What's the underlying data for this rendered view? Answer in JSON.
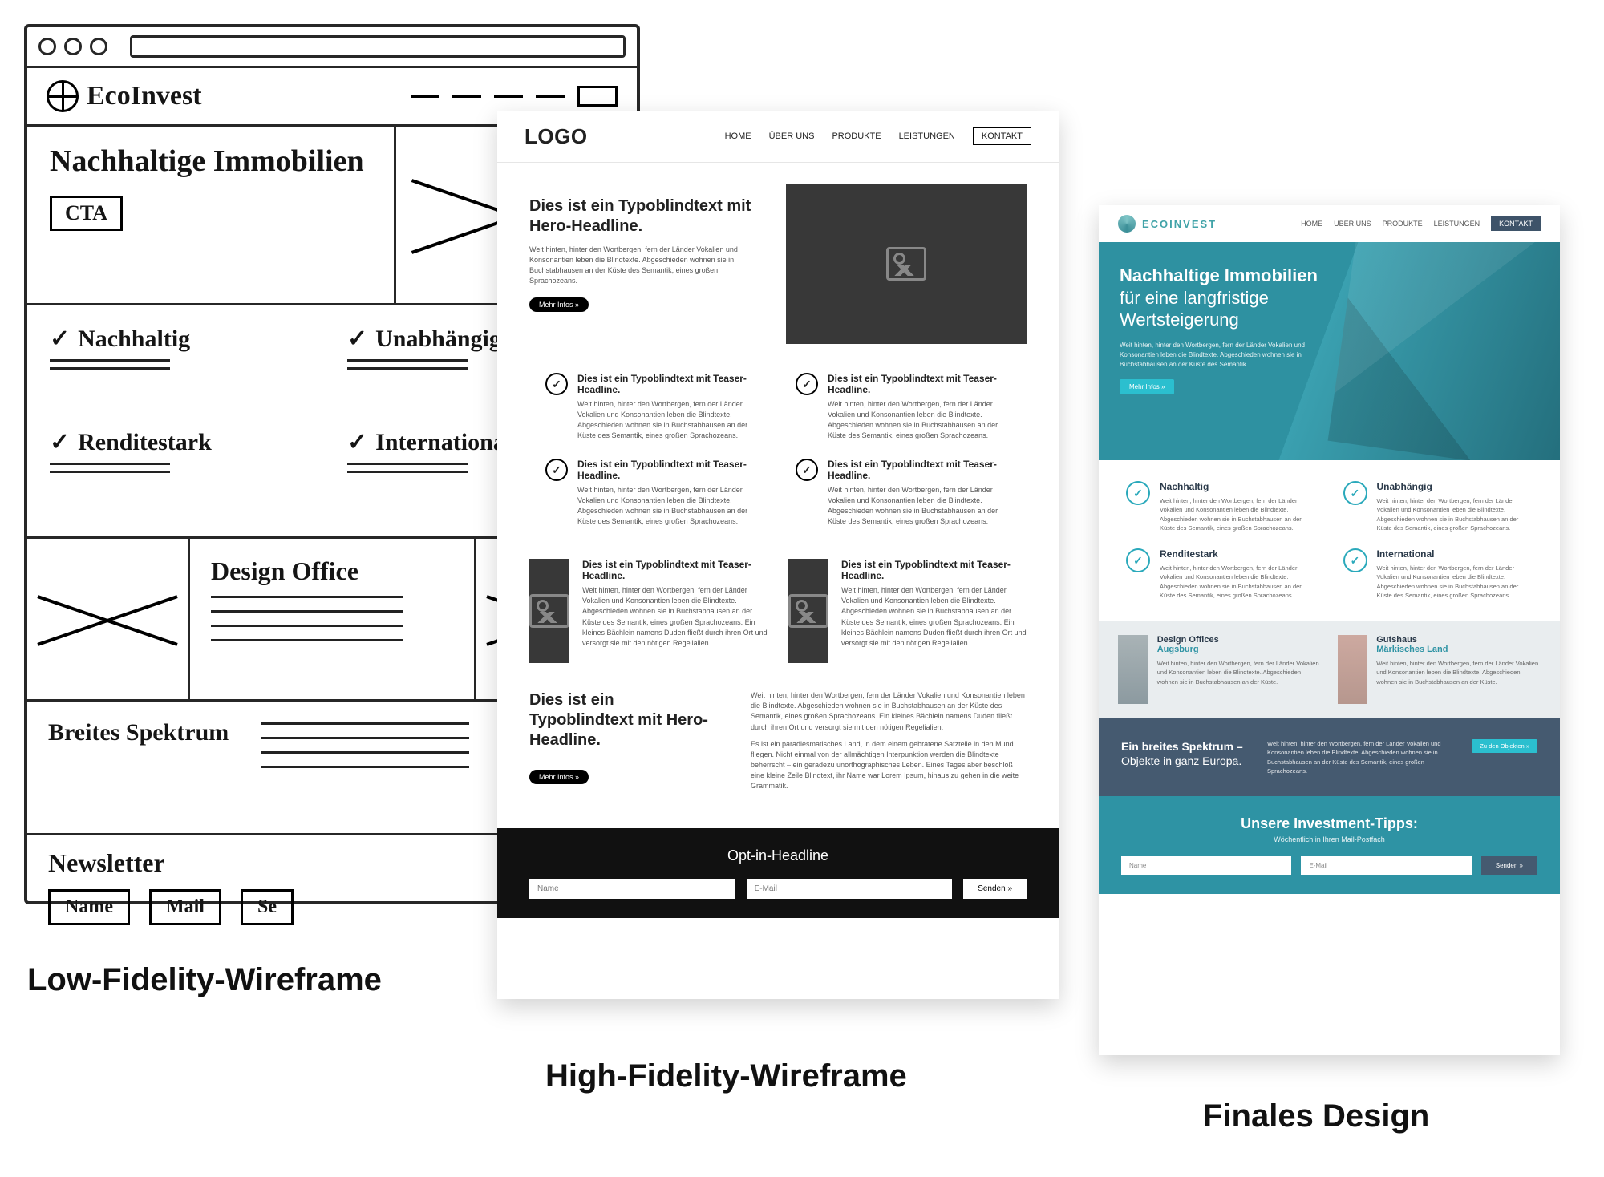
{
  "captions": {
    "low": "Low-Fidelity-Wireframe",
    "high": "High-Fidelity-Wireframe",
    "final": "Finales Design"
  },
  "lofi": {
    "brand": "EcoInvest",
    "hero": {
      "headline": "Nachhaltige Immobilien",
      "cta": "CTA"
    },
    "features": [
      "Nachhaltig",
      "Unabhängig",
      "Renditestark",
      "International"
    ],
    "project": "Design Office",
    "spectrum": "Breites Spektrum",
    "newsletter": {
      "title": "Newsletter",
      "name": "Name",
      "mail": "Mail",
      "send": "Se"
    }
  },
  "hifi": {
    "logo": "LOGO",
    "nav": [
      "HOME",
      "ÜBER UNS",
      "PRODUKTE",
      "LEISTUNGEN"
    ],
    "nav_contact": "KONTAKT",
    "hero": {
      "headline": "Dies ist ein Typoblindtext mit Hero-Headline.",
      "body": "Weit hinten, hinter den Wortbergen, fern der Länder Vokalien und Konsonantien leben die Blindtexte. Abgeschieden wohnen sie in Buchstabhausen an der Küste des Semantik, eines großen Sprachozeans.",
      "button": "Mehr Infos »"
    },
    "feature": {
      "title": "Dies ist ein Typoblindtext mit Teaser-Headline.",
      "body": "Weit hinten, hinter den Wortbergen, fern der Länder Vokalien und Konsonantien leben die Blindtexte. Abgeschieden wohnen sie in Buchstabhausen an der Küste des Semantik, eines großen Sprachozeans."
    },
    "project": {
      "title": "Dies ist ein Typoblindtext mit Teaser-Headline.",
      "body": "Weit hinten, hinter den Wortbergen, fern der Länder Vokalien und Konsonantien leben die Blindtexte. Abgeschieden wohnen sie in Buchstabhausen an der Küste des Semantik, eines großen Sprachozeans. Ein kleines Bächlein namens Duden fließt durch ihren Ort und versorgt sie mit den nötigen Regelialien."
    },
    "cta2": {
      "headline": "Dies ist ein Typoblindtext mit Hero-Headline.",
      "button": "Mehr Infos »",
      "body1": "Weit hinten, hinter den Wortbergen, fern der Länder Vokalien und Konsonantien leben die Blindtexte. Abgeschieden wohnen sie in Buchstabhausen an der Küste des Semantik, eines großen Sprachozeans. Ein kleines Bächlein namens Duden fließt durch ihren Ort und versorgt sie mit den nötigen Regelialien.",
      "body2": "Es ist ein paradiesmatisches Land, in dem einem gebratene Satzteile in den Mund fliegen. Nicht einmal von der allmächtigen Interpunktion werden die Blindtexte beherrscht – ein geradezu unorthographisches Leben. Eines Tages aber beschloß eine kleine Zeile Blindtext, ihr Name war Lorem Ipsum, hinaus zu gehen in die weite Grammatik."
    },
    "footer": {
      "headline": "Opt-in-Headline",
      "name": "Name",
      "email": "E-Mail",
      "send": "Senden »"
    }
  },
  "final": {
    "brand": "ECOINVEST",
    "nav": [
      "HOME",
      "ÜBER UNS",
      "PRODUKTE",
      "LEISTUNGEN"
    ],
    "nav_contact": "KONTAKT",
    "hero": {
      "line1": "Nachhaltige Immobilien",
      "line2": "für eine langfristige",
      "line3": "Wertsteigerung",
      "body": "Weit hinten, hinter den Wortbergen, fern der Länder Vokalien und Konsonantien leben die Blindtexte. Abgeschieden wohnen sie in Buchstabhausen an der Küste des Semantik.",
      "button": "Mehr Infos »"
    },
    "features": [
      {
        "title": "Nachhaltig",
        "body": "Weit hinten, hinter den Wortbergen, fern der Länder Vokalien und Konsonantien leben die Blindtexte. Abgeschieden wohnen sie in Buchstabhausen an der Küste des Semantik, eines großen Sprachozeans."
      },
      {
        "title": "Unabhängig",
        "body": "Weit hinten, hinter den Wortbergen, fern der Länder Vokalien und Konsonantien leben die Blindtexte. Abgeschieden wohnen sie in Buchstabhausen an der Küste des Semantik, eines großen Sprachozeans."
      },
      {
        "title": "Renditestark",
        "body": "Weit hinten, hinter den Wortbergen, fern der Länder Vokalien und Konsonantien leben die Blindtexte. Abgeschieden wohnen sie in Buchstabhausen an der Küste des Semantik, eines großen Sprachozeans."
      },
      {
        "title": "International",
        "body": "Weit hinten, hinter den Wortbergen, fern der Länder Vokalien und Konsonantien leben die Blindtexte. Abgeschieden wohnen sie in Buchstabhausen an der Küste des Semantik, eines großen Sprachozeans."
      }
    ],
    "projects": [
      {
        "title": "Design Offices",
        "sub": "Augsburg",
        "body": "Weit hinten, hinter den Wortbergen, fern der Länder Vokalien und Konsonantien leben die Blindtexte. Abgeschieden wohnen sie in Buchstabhausen an der Küste."
      },
      {
        "title": "Gutshaus",
        "sub": "Märkisches Land",
        "body": "Weit hinten, hinter den Wortbergen, fern der Länder Vokalien und Konsonantien leben die Blindtexte. Abgeschieden wohnen sie in Buchstabhausen an der Küste."
      }
    ],
    "spectrum": {
      "line1": "Ein breites Spektrum –",
      "line2": "Objekte in ganz Europa.",
      "body": "Weit hinten, hinter den Wortbergen, fern der Länder Vokalien und Konsonantien leben die Blindtexte. Abgeschieden wohnen sie in Buchstabhausen an der Küste des Semantik, eines großen Sprachozeans.",
      "button": "Zu den Objekten »"
    },
    "newsletter": {
      "headline": "Unsere Investment-Tipps:",
      "sub": "Wöchentlich in Ihren Mail-Postfach",
      "name": "Name",
      "email": "E-Mail",
      "send": "Senden »"
    },
    "colors": {
      "teal": "#2e93a4",
      "teal_light": "#2bbfcf",
      "slate": "#455a70"
    }
  }
}
